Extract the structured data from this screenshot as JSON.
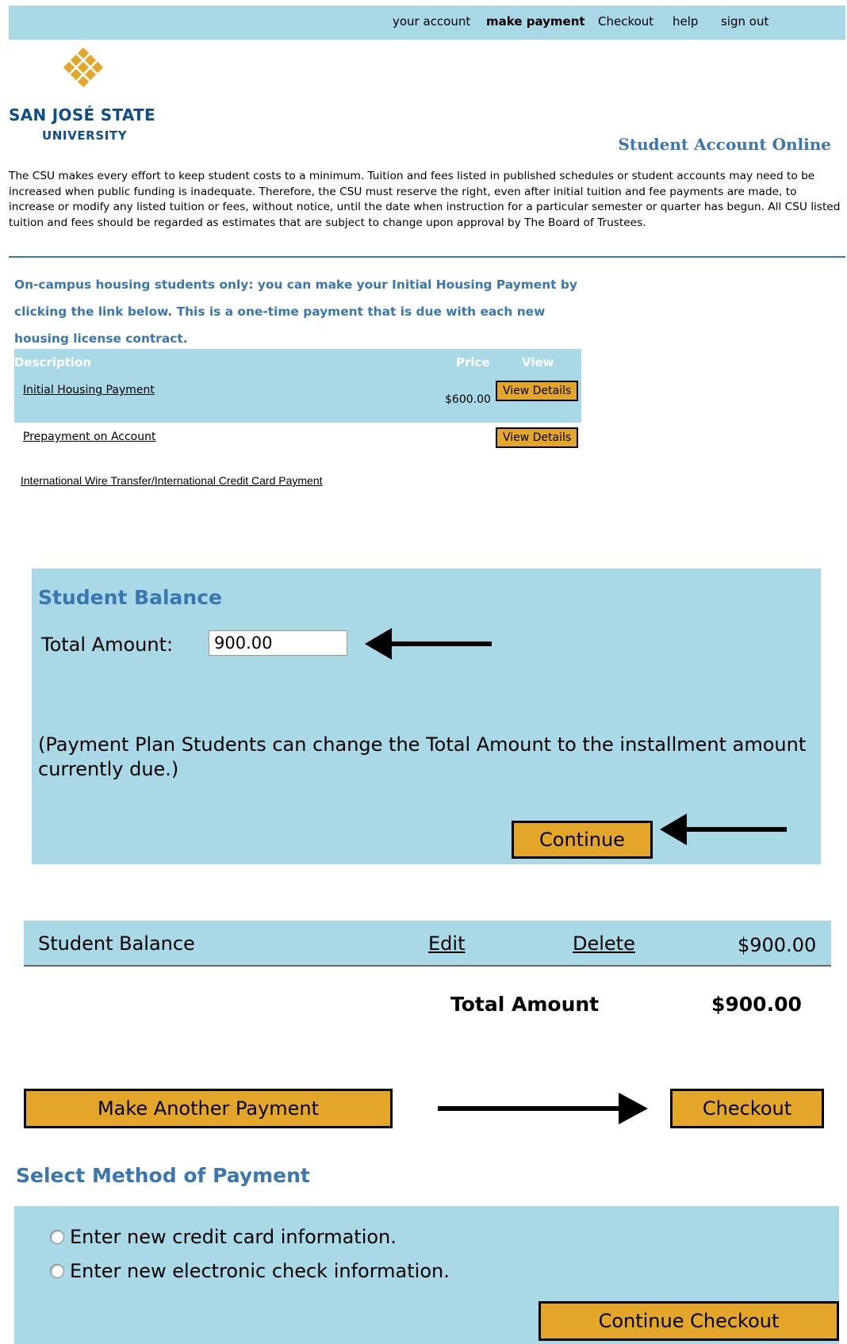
{
  "nav": {
    "items": [
      "your account",
      "make payment",
      "Checkout",
      "help",
      "sign out"
    ],
    "active": "make payment"
  },
  "logo": {
    "line1": "SAN JOSÉ STATE",
    "line2": "UNIVERSITY",
    "icon": "sjsu-diamond-logo",
    "color": "#e3a628"
  },
  "page_title": "Student Account Online",
  "disclaimer": "The CSU makes every effort to keep student costs to a minimum. Tuition and fees listed in published schedules or student accounts may need to be increased when public funding is inadequate. Therefore, the CSU must reserve the right, even after initial tuition and fee payments are made, to increase or modify any listed tuition or fees, without notice, until the date when instruction for a particular semester or quarter has begun. All CSU listed tuition and fees should be regarded as estimates that are subject to change upon approval by The Board of Trustees.",
  "housing_note": "On-campus housing students only: you can make your Initial Housing Payment by clicking the link below.  This is a one-time payment that is due with each new housing license contract.",
  "payment_table": {
    "headers": {
      "description": "Description",
      "price": "Price",
      "view": "View"
    },
    "rows": [
      {
        "description": "Initial Housing Payment",
        "price": "$600.00",
        "button": "View Details"
      },
      {
        "description": "Prepayment on Account",
        "price": "",
        "button": "View Details"
      }
    ]
  },
  "intl_link": "International Wire Transfer/International Credit Card Payment",
  "student_balance": {
    "title": "Student Balance",
    "label": "Total Amount:",
    "value": "900.00",
    "note": "(Payment Plan Students can change the Total Amount to the installment amount currently due.)",
    "continue": "Continue"
  },
  "cart": {
    "item": "Student Balance",
    "edit": "Edit",
    "delete": "Delete",
    "amount": "$900.00",
    "total_label": "Total Amount",
    "total_value": "$900.00"
  },
  "actions": {
    "make_another": "Make Another Payment",
    "checkout": "Checkout"
  },
  "method": {
    "title": "Select Method of Payment",
    "options": [
      "Enter new credit card information.",
      "Enter new electronic check information."
    ],
    "continue_checkout": "Continue Checkout"
  },
  "colors": {
    "accent_blue": "#3a76b0",
    "panel_bg": "#a9d8e6",
    "button_gold": "#e3a628"
  }
}
